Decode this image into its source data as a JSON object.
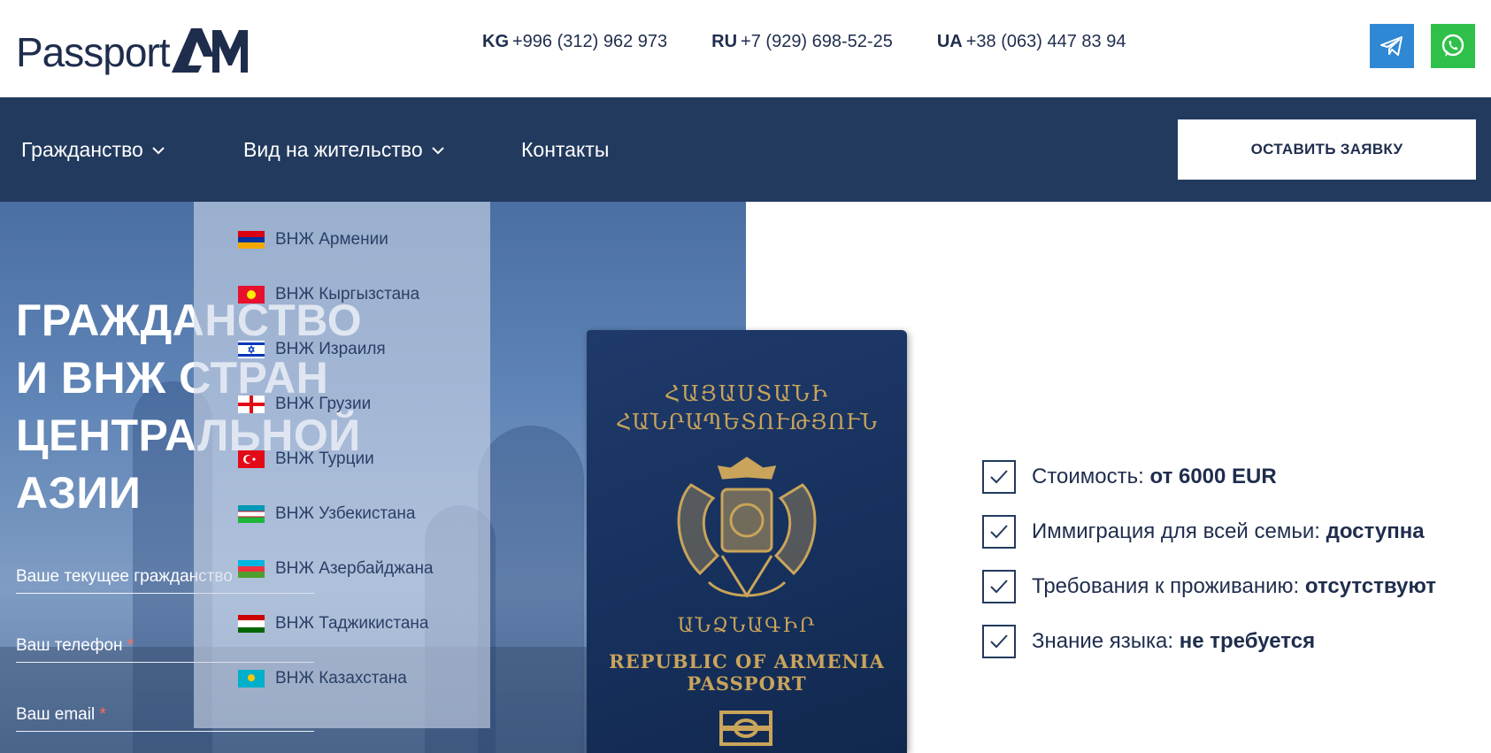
{
  "header": {
    "logo_text": "Passport",
    "logo_mark": "AM",
    "phones": [
      {
        "code": "KG",
        "number": "+996 (312) 962 973"
      },
      {
        "code": "RU",
        "number": "+7 (929) 698-52-25"
      },
      {
        "code": "UA",
        "number": "+38 (063) 447 83 94"
      }
    ],
    "social": [
      {
        "name": "telegram-icon",
        "color": "#2f88d3"
      },
      {
        "name": "whatsapp-icon",
        "color": "#2fc04a"
      }
    ]
  },
  "nav": {
    "items": [
      {
        "label": "Гражданство",
        "has_dropdown": true
      },
      {
        "label": "Вид на жительство",
        "has_dropdown": true
      },
      {
        "label": "Контакты",
        "has_dropdown": false
      }
    ],
    "cta_label": "ОСТАВИТЬ ЗАЯВКУ",
    "background": "#223a5e"
  },
  "dropdown": {
    "items": [
      {
        "label": "ВНЖ Армении",
        "flag": "armenia"
      },
      {
        "label": "ВНЖ Кыргызстана",
        "flag": "kyrgyzstan"
      },
      {
        "label": "ВНЖ Израиля",
        "flag": "israel"
      },
      {
        "label": "ВНЖ Грузии",
        "flag": "georgia"
      },
      {
        "label": "ВНЖ Турции",
        "flag": "turkey"
      },
      {
        "label": "ВНЖ Узбекистана",
        "flag": "uzbekistan"
      },
      {
        "label": "ВНЖ Азербайджана",
        "flag": "azerbaijan"
      },
      {
        "label": "ВНЖ Таджикистана",
        "flag": "tajikistan"
      },
      {
        "label": "ВНЖ Казахстана",
        "flag": "kazakhstan"
      }
    ]
  },
  "hero": {
    "title_lines": [
      "ГРАЖДАНСТВО",
      "И ВНЖ СТРАН",
      "ЦЕНТРАЛЬНОЙ",
      "АЗИИ"
    ],
    "form": {
      "citizenship_label": "Ваше текущее гражданство",
      "phone_label": "Ваш телефон",
      "email_label": "Ваш email",
      "required_mark": "*"
    }
  },
  "passport": {
    "armenian_line1": "ՀԱՅԱՍՏԱՆԻ",
    "armenian_line2": "ՀԱՆՐԱՊԵՏՈՒԹՅՈՒՆ",
    "armenian_line3": "ԱՆՁՆԱԳԻՐ",
    "english_line1": "REPUBLIC OF ARMENIA",
    "english_line2": "PASSPORT"
  },
  "features": [
    {
      "label": "Стоимость:",
      "value": "от 6000 EUR"
    },
    {
      "label": "Иммиграция для всей семьи:",
      "value": "доступна"
    },
    {
      "label": "Требования к проживанию:",
      "value": "отсутствуют"
    },
    {
      "label": "Знание языка:",
      "value": "не требуется"
    }
  ]
}
